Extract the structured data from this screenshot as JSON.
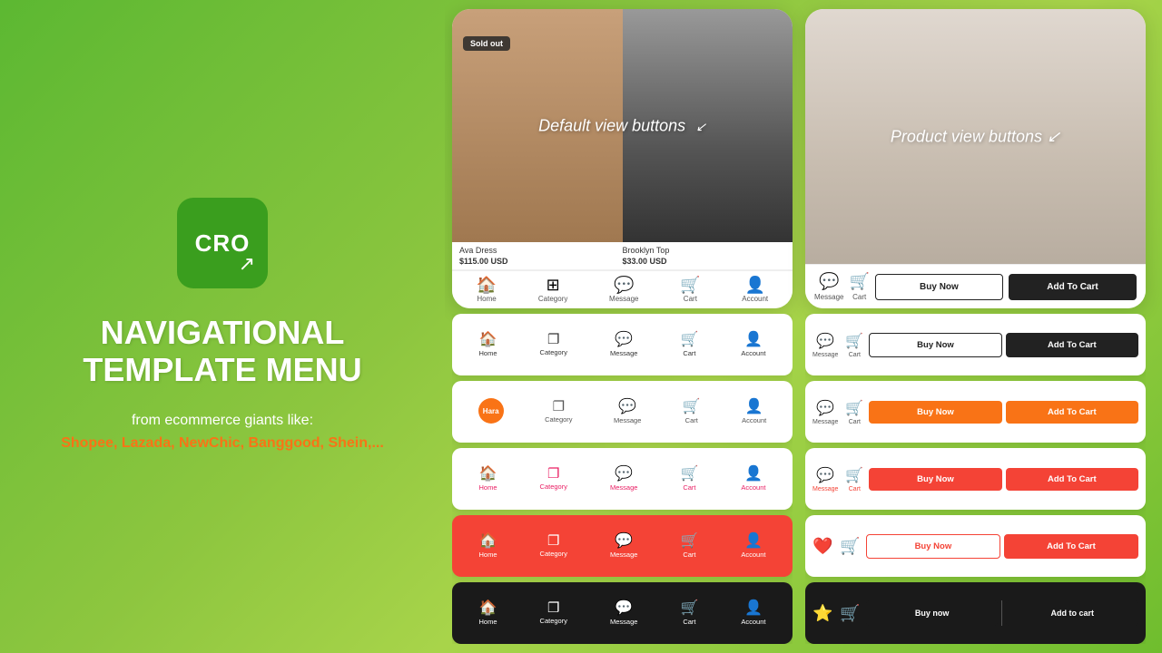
{
  "left": {
    "logo_text": "CRO",
    "title_line1": "NAVIGATIONAL",
    "title_line2": "TEMPLATE MENU",
    "subtitle_prefix": "from ecommerce giants like:",
    "subtitle_brands": "Shopee, Lazada, NewChic, Banggood, Shein,..."
  },
  "phone_card_left": {
    "product1_name": "Ava Dress",
    "product1_price": "$115.00 USD",
    "product2_name": "Brooklyn Top",
    "product2_price": "$33.00 USD",
    "sold_out_label": "Sold out",
    "overlay_label": "Default view buttons",
    "nav_items": [
      {
        "icon": "⌂",
        "label": "Home"
      },
      {
        "icon": "⊞",
        "label": "Category"
      },
      {
        "icon": "◉",
        "label": "Message"
      },
      {
        "icon": "⊡",
        "label": "Cart"
      },
      {
        "icon": "⊙",
        "label": "Account"
      }
    ]
  },
  "phone_card_right": {
    "overlay_label": "Product view buttons",
    "buy_now_label": "Buy Now",
    "add_to_cart_label": "Add To Cart",
    "msg_label": "Message",
    "cart_label": "Cart"
  },
  "nav_bars": [
    {
      "style": "default",
      "items": [
        {
          "icon": "🏠",
          "label": "Home"
        },
        {
          "icon": "⊞",
          "label": "Category"
        },
        {
          "icon": "💬",
          "label": "Message"
        },
        {
          "icon": "🛒",
          "label": "Cart"
        },
        {
          "icon": "👤",
          "label": "Account"
        }
      ]
    },
    {
      "style": "hara",
      "items": [
        {
          "icon": "hara",
          "label": ""
        },
        {
          "icon": "⊞",
          "label": "Category"
        },
        {
          "icon": "💬",
          "label": "Message"
        },
        {
          "icon": "🛒",
          "label": "Cart"
        },
        {
          "icon": "👤",
          "label": "Account"
        }
      ]
    },
    {
      "style": "pink",
      "items": [
        {
          "icon": "🏠",
          "label": "Home"
        },
        {
          "icon": "⊞",
          "label": "Category"
        },
        {
          "icon": "💬",
          "label": "Message"
        },
        {
          "icon": "🛒",
          "label": "Cart"
        },
        {
          "icon": "👤",
          "label": "Account"
        }
      ]
    },
    {
      "style": "red",
      "items": [
        {
          "icon": "🏠",
          "label": "Home"
        },
        {
          "icon": "⊞",
          "label": "Category"
        },
        {
          "icon": "💬",
          "label": "Message"
        },
        {
          "icon": "🛒",
          "label": "Cart"
        },
        {
          "icon": "👤",
          "label": "Account"
        }
      ]
    },
    {
      "style": "dark",
      "items": [
        {
          "icon": "🏠",
          "label": "Home"
        },
        {
          "icon": "⊞",
          "label": "Category"
        },
        {
          "icon": "💬",
          "label": "Message"
        },
        {
          "icon": "🛒",
          "label": "Cart"
        },
        {
          "icon": "👤",
          "label": "Account"
        }
      ]
    }
  ],
  "pv_bars": [
    {
      "style": "default",
      "msg_icon": "💬",
      "msg_label": "Message",
      "cart_icon": "🛒",
      "cart_label": "Cart",
      "left_icon": "heart",
      "buy_label": "Buy Now",
      "cart_label2": "Add To Cart"
    },
    {
      "style": "orange",
      "msg_icon": "💬",
      "msg_label": "Message",
      "cart_icon": "🛒",
      "cart_label": "Cart",
      "buy_label": "Buy Now",
      "cart_label2": "Add To Cart"
    },
    {
      "style": "red",
      "msg_icon": "💬",
      "msg_label": "Message",
      "cart_icon": "🛒",
      "cart_label": "Cart",
      "buy_label": "Buy Now",
      "cart_label2": "Add To Cart"
    },
    {
      "style": "heart",
      "msg_icon": "💬",
      "msg_label": "",
      "cart_icon": "🛒",
      "cart_label": "",
      "buy_label": "Buy Now",
      "cart_label2": "Add To Cart"
    },
    {
      "style": "dark",
      "msg_icon": "⭐",
      "msg_label": "",
      "cart_icon": "🛒",
      "cart_label": "",
      "buy_label": "Buy now",
      "cart_label2": "Add to cart"
    }
  ]
}
